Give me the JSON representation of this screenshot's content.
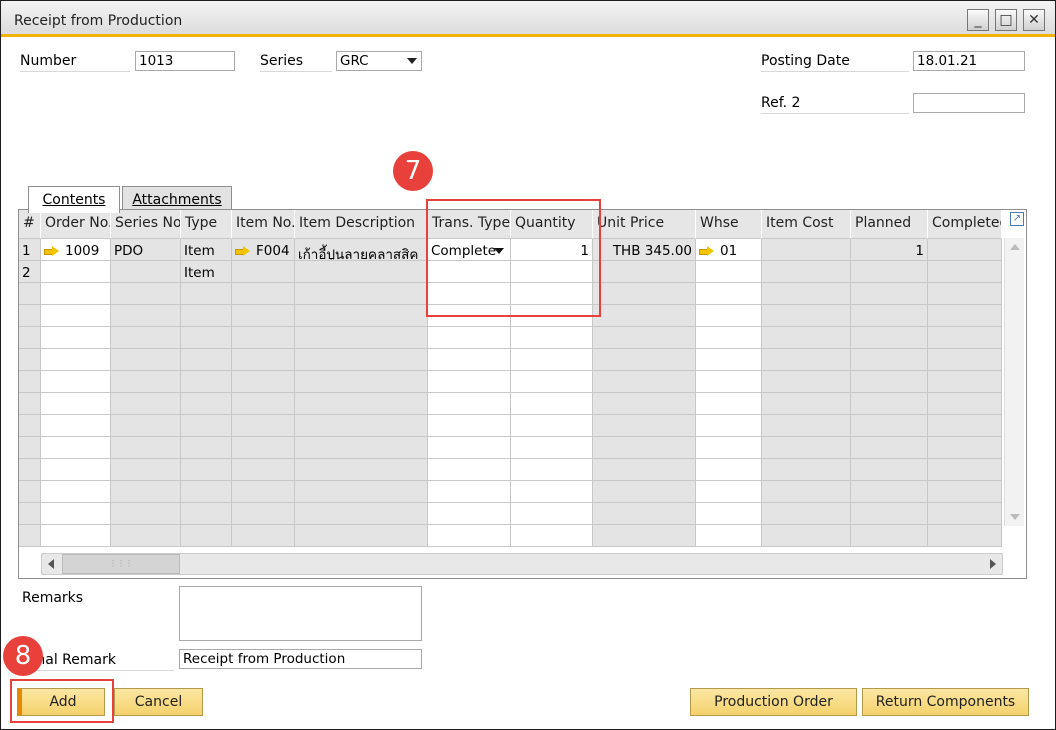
{
  "window": {
    "title": "Receipt from Production",
    "minimize": "_",
    "maximize": "□",
    "close": "✕"
  },
  "header": {
    "number_label": "Number",
    "number_value": "1013",
    "series_label": "Series",
    "series_value": "GRC",
    "posting_date_label": "Posting Date",
    "posting_date_value": "18.01.21",
    "ref2_label": "Ref. 2",
    "ref2_value": ""
  },
  "tabs": [
    {
      "label": "Contents"
    },
    {
      "label": "Attachments"
    }
  ],
  "grid": {
    "columns": [
      "#",
      "Order No.",
      "Series No.",
      "Type",
      "Item No.",
      "Item Description",
      "Trans. Type",
      "Quantity",
      "Unit Price",
      "Whse",
      "Item Cost",
      "Planned",
      "Completed"
    ],
    "rows": [
      {
        "idx": "1",
        "order": "1009",
        "series": "PDO",
        "type": "Item",
        "item": "F004",
        "desc": "เก้าอี้ปูนลายคลาสสิค",
        "trans": "Complete",
        "qty": "1",
        "price": "THB 345.00",
        "whse": "01",
        "cost": "",
        "planned": "1",
        "completed": ""
      },
      {
        "idx": "2",
        "order": "",
        "series": "",
        "type": "Item",
        "item": "",
        "desc": "",
        "trans": "",
        "qty": "",
        "price": "",
        "whse": "",
        "cost": "",
        "planned": "",
        "completed": ""
      }
    ]
  },
  "footer": {
    "remarks_label": "Remarks",
    "remarks_value": "",
    "journal_label": "urnal Remark",
    "journal_value": "Receipt from Production"
  },
  "buttons": {
    "add": "Add",
    "cancel": "Cancel",
    "production_order": "Production Order",
    "return_components": "Return Components"
  },
  "annotations": {
    "step7": "7",
    "step8": "8"
  },
  "colors": {
    "accent": "#f0b400",
    "highlight": "#e8403a",
    "button": "#f5d16b"
  }
}
